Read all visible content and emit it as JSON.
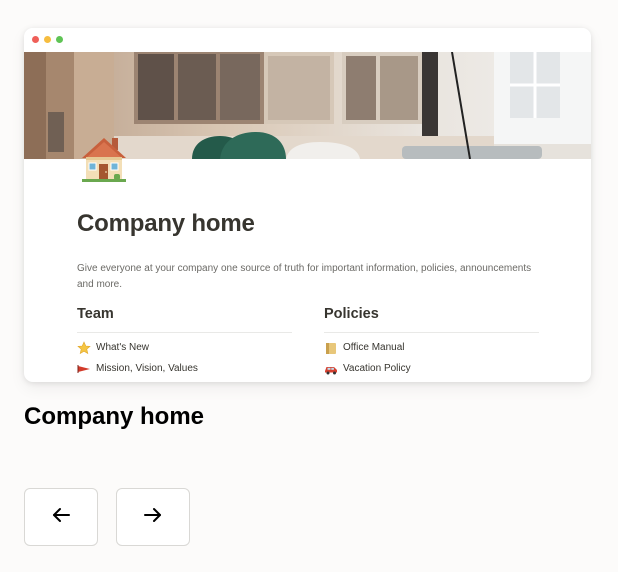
{
  "window": {
    "traffic_lights": [
      "close",
      "minimize",
      "maximize"
    ]
  },
  "cover": {
    "icon": "office-cover-image"
  },
  "page": {
    "icon": "house-icon",
    "title": "Company home",
    "description": "Give everyone at your company one source of truth for important information, policies, announcements and more."
  },
  "columns": {
    "team": {
      "heading": "Team",
      "items": [
        {
          "icon": "star-icon",
          "label": "What's New"
        },
        {
          "icon": "flag-icon",
          "label": "Mission, Vision, Values"
        }
      ]
    },
    "policies": {
      "heading": "Policies",
      "items": [
        {
          "icon": "scroll-icon",
          "label": "Office Manual"
        },
        {
          "icon": "car-icon",
          "label": "Vacation Policy"
        }
      ]
    }
  },
  "caption": "Company home",
  "navigation": {
    "prev_icon": "arrow-left-icon",
    "next_icon": "arrow-right-icon"
  },
  "colors": {
    "background": "#fcfbfa",
    "text": "#37352f",
    "muted_text": "#6b6a66"
  }
}
